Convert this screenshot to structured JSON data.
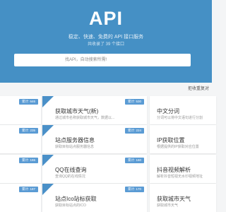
{
  "header": {
    "title": "API",
    "subtitle": "稳定、快速、免费的 API 接口服务",
    "count": "共收录了 39 个接口"
  },
  "search": {
    "placeholder": "找API，自动搜索所需!"
  },
  "notice": "拒收重复对",
  "colors": {
    "header_bg": "#4590c5",
    "badge_bg": "#5a9bd4",
    "page_bg": "#f4f5f6"
  },
  "cards": [
    {
      "title": "",
      "desc": "",
      "badge": "累计: 646"
    },
    {
      "title": "获取城市天气(新)",
      "desc": "通过城市名称获取城市天气，数据以...",
      "badge": "累计: 530"
    },
    {
      "title": "中文分词",
      "desc": "分词可以将中文语句进行分割",
      "badge": ""
    },
    {
      "title": "",
      "desc": "",
      "badge": "累计: 235"
    },
    {
      "title": "站点服务器信息",
      "desc": "获取目标站点服务器信息",
      "badge": "累计: 224"
    },
    {
      "title": "IP获取位置",
      "desc": "根据提供的IP获取对应位置",
      "badge": ""
    },
    {
      "title": "",
      "desc": "",
      "badge": "累计: 155"
    },
    {
      "title": "QQ在线查询",
      "desc": "查询QQ的在线情况",
      "badge": "累计: 160"
    },
    {
      "title": "抖音视频解析",
      "desc": "解析抖音短视无水印视频地址",
      "badge": ""
    },
    {
      "title": "",
      "desc": "",
      "badge": "累计: 187"
    },
    {
      "title": "站点Ico站标获取",
      "desc": "获取目标站点的ICO",
      "badge": "累计: 170"
    },
    {
      "title": "获取城市天气",
      "desc": "获取城市天气",
      "badge": ""
    }
  ]
}
